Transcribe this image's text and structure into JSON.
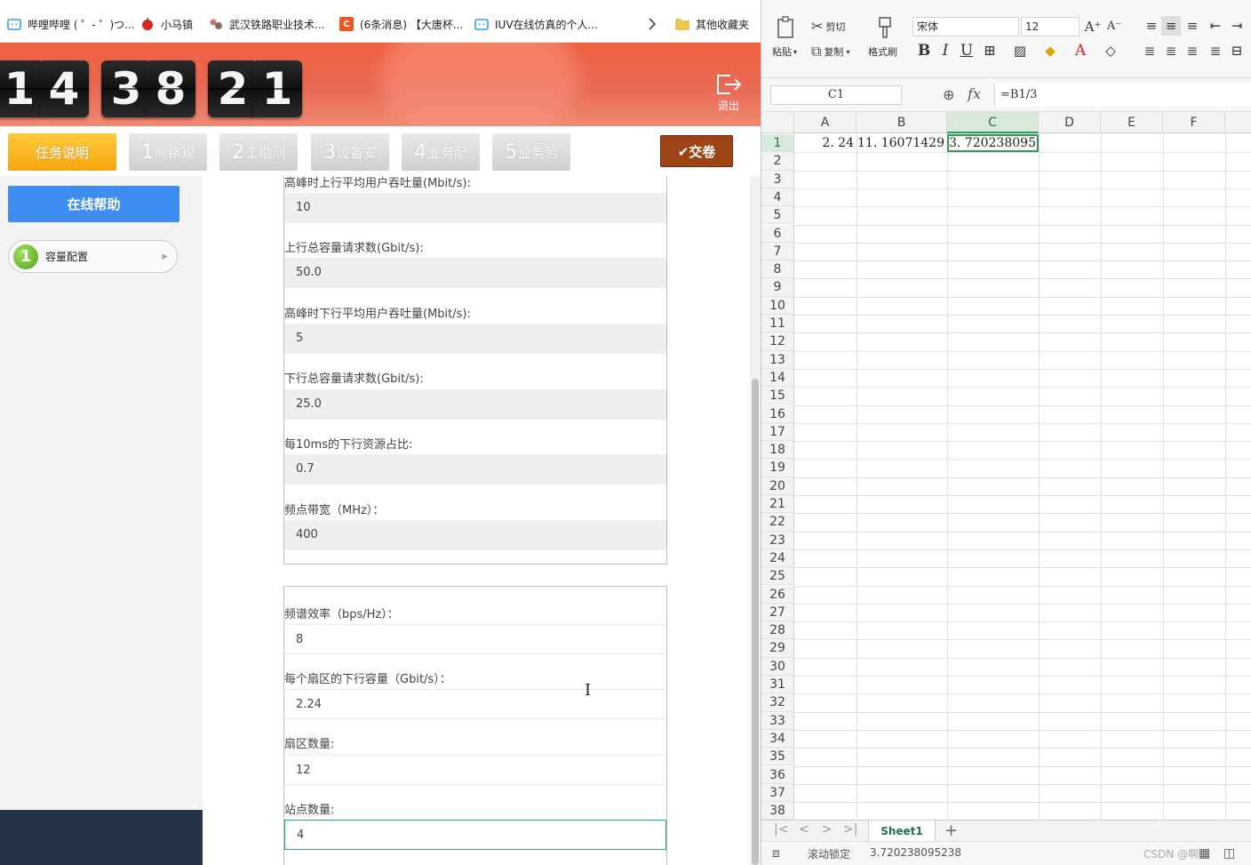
{
  "bookmarks": [
    {
      "label": "哔哩哔哩 ( ゜- ゜)つ...",
      "icon": "bilibili-icon"
    },
    {
      "label": "小马镇",
      "icon": "apple-icon"
    },
    {
      "label": "武汉铁路职业技术...",
      "icon": "school-icon"
    },
    {
      "label": "(6条消息) 【大唐杯...",
      "icon": "csdn-icon"
    },
    {
      "label": "IUV在线仿真的个人...",
      "icon": "bilibili-icon"
    },
    {
      "label": "其他收藏夹",
      "icon": "folder-icon"
    }
  ],
  "timer": [
    "1",
    "4",
    "3",
    "8",
    "2",
    "1"
  ],
  "logout_label": "退出",
  "tabs": [
    {
      "num": "",
      "label": "任务说明"
    },
    {
      "num": "1",
      "label": "网络规"
    },
    {
      "num": "2",
      "label": "工勘测"
    },
    {
      "num": "3",
      "label": "设备安"
    },
    {
      "num": "4",
      "label": "业务配"
    },
    {
      "num": "5",
      "label": "业务验"
    }
  ],
  "submit_label": "✔交卷",
  "sidebar": {
    "help_label": "在线帮助",
    "step_num": "1",
    "step_label": "容量配置"
  },
  "form": {
    "group1": [
      {
        "label": "高峰时上行平均用户吞吐量(Mbit/s):",
        "value": "10"
      },
      {
        "label": "上行总容量请求数(Gbit/s):",
        "value": "50.0"
      },
      {
        "label": "高峰时下行平均用户吞吐量(Mbit/s):",
        "value": "5"
      },
      {
        "label": "下行总容量请求数(Gbit/s):",
        "value": "25.0"
      },
      {
        "label": "每10ms的下行资源占比:",
        "value": "0.7"
      },
      {
        "label": "频点带宽（MHz）：",
        "value": "400"
      }
    ],
    "group2": [
      {
        "label": "频谱效率（bps/Hz）：",
        "value": "8"
      },
      {
        "label": "每个扇区的下行容量（Gbit/s）：",
        "value": "2.24"
      },
      {
        "label": "扇区数量:",
        "value": "12"
      },
      {
        "label": "站点数量:",
        "value": "4"
      }
    ]
  },
  "spreadsheet": {
    "ribbon": {
      "paste": "粘贴",
      "cut": "剪切",
      "copy": "复制",
      "format_painter": "格式刷",
      "font_name": "宋体",
      "font_size": "12"
    },
    "name_box": "C1",
    "formula": "=B1/3",
    "columns": [
      "A",
      "B",
      "C",
      "D",
      "E",
      "F"
    ],
    "rows": [
      "1",
      "2",
      "3",
      "4",
      "5",
      "6",
      "7",
      "8",
      "9",
      "10",
      "11",
      "12",
      "13",
      "14",
      "15",
      "16",
      "17",
      "18",
      "19",
      "20",
      "21",
      "22",
      "23",
      "24",
      "25",
      "26",
      "27",
      "28",
      "29",
      "30",
      "31",
      "32",
      "33",
      "34",
      "35",
      "36",
      "37",
      "38"
    ],
    "cells": {
      "A1": "2. 24",
      "B1": "11. 16071429",
      "C1": "3. 720238095"
    },
    "sheet_tab": "Sheet1",
    "status_left": "滚动锁定",
    "status_value": "3.720238095238",
    "status_watermark": "CSDN @啊..."
  }
}
